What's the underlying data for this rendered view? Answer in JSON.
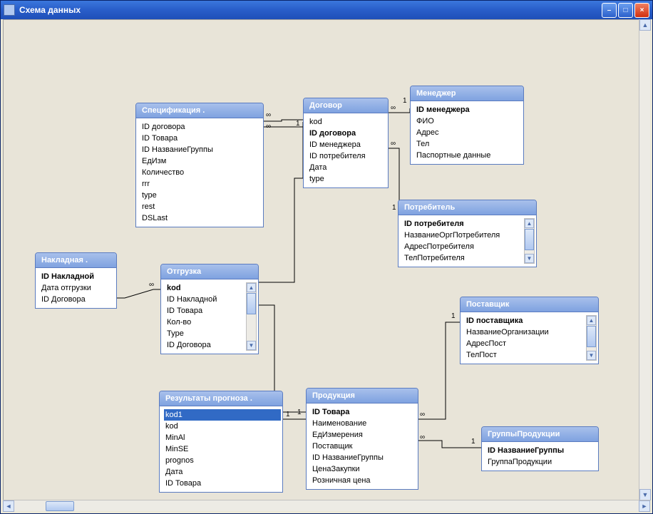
{
  "window": {
    "title": "Схема данных"
  },
  "cardinality": {
    "one": "1",
    "many": "∞"
  },
  "tables": {
    "spec": {
      "title": "Спецификация .",
      "fields": [
        "ID договора",
        "ID Товара",
        "ID НазваниеГруппы",
        "ЕдИзм",
        "Количество",
        "rrr",
        "type",
        "rest",
        "DSLast"
      ]
    },
    "dogovor": {
      "title": "Договор",
      "fields": [
        "kod",
        "ID договора",
        "ID менеджера",
        "ID потребителя",
        "Дата",
        "type"
      ]
    },
    "manager": {
      "title": "Менеджер",
      "fields": [
        "ID менеджера",
        "ФИО",
        "Адрес",
        "Тел",
        "Паспортные данные"
      ]
    },
    "potreb": {
      "title": "Потребитель",
      "fields": [
        "ID потребителя",
        "НазваниеОргПотребителя",
        "АдресПотребителя",
        "ТелПотребителя"
      ]
    },
    "naklad": {
      "title": "Накладная .",
      "fields": [
        "ID Накладной",
        "Дата отгрузки",
        "ID Договора"
      ]
    },
    "otgruz": {
      "title": "Отгрузка",
      "fields": [
        "kod",
        "ID Накладной",
        "ID Товара",
        "Кол-во",
        "Type",
        "ID Договора"
      ]
    },
    "postav": {
      "title": "Поставщик",
      "fields": [
        "ID поставщика",
        "НазваниеОрганизации",
        "АдресПост",
        "ТелПост"
      ]
    },
    "rezult": {
      "title": "Результаты прогноза .",
      "fields": [
        "kod1",
        "kod",
        "MinAl",
        "MinSE",
        "prognos",
        "Дата",
        "ID Товара"
      ]
    },
    "product": {
      "title": "Продукция",
      "fields": [
        "ID Товара",
        "Наименование",
        "ЕдИзмерения",
        "Поставщик",
        "ID НазваниеГруппы",
        "ЦенаЗакупки",
        "Розничная цена"
      ]
    },
    "group": {
      "title": "ГруппыПродукции",
      "fields": [
        "ID НазваниеГруппы",
        "ГруппаПродукции"
      ]
    }
  }
}
